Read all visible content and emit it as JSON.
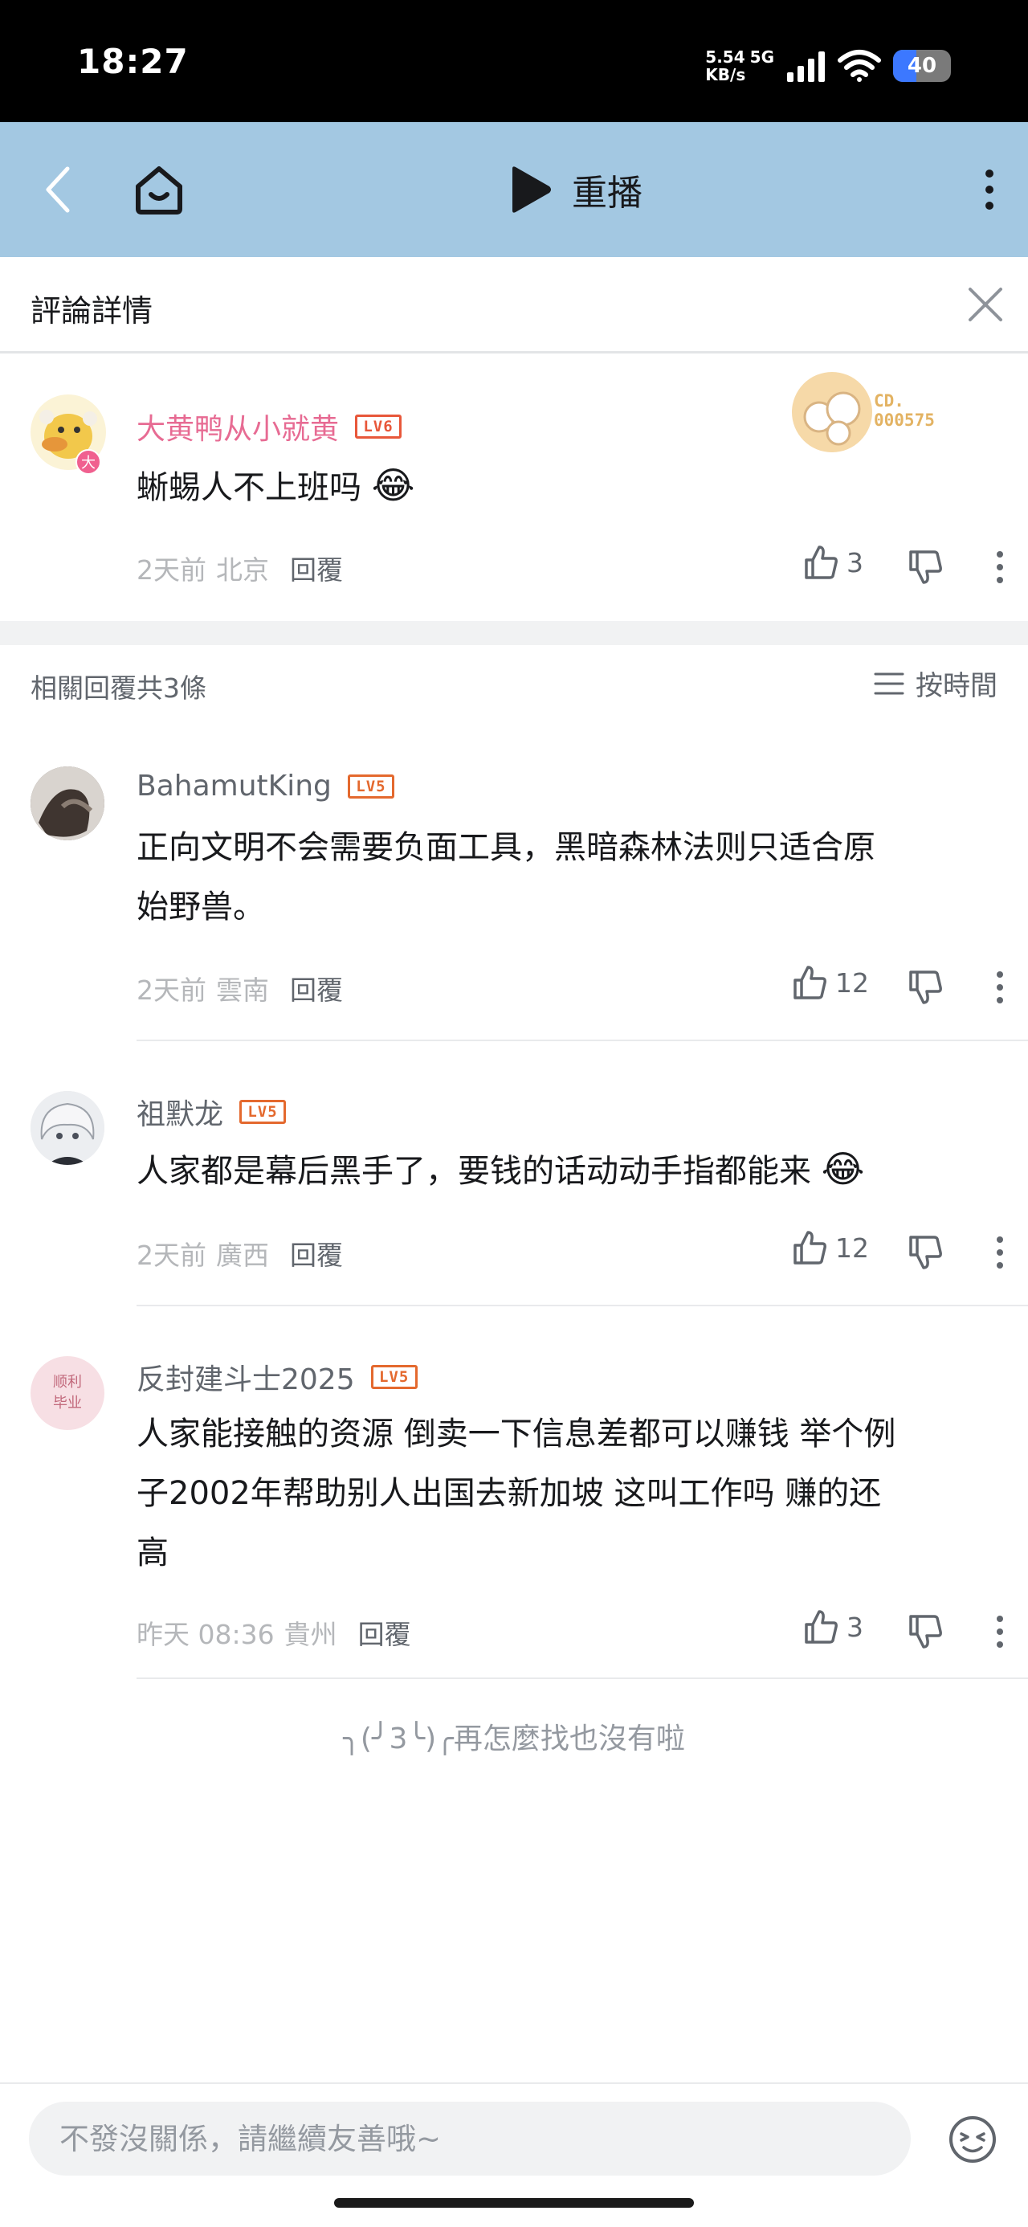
{
  "status_bar": {
    "time": "18:27",
    "net_speed_value": "5.54",
    "net_speed_unit": "KB/s",
    "network": "5G",
    "battery": "40",
    "battery_level": 0.4
  },
  "nav": {
    "replay_label": "重播"
  },
  "detail": {
    "title": "評論詳情"
  },
  "root_comment": {
    "username": "大黄鸭从小就黄",
    "level": "LV6",
    "avatar_badge": "大",
    "fan_badge_text_1": "CD.",
    "fan_badge_text_2": "000575",
    "text": "蜥蜴人不上班吗",
    "emoji": "😂",
    "time": "2天前",
    "location": "北京",
    "reply_label": "回覆",
    "likes": "3"
  },
  "replies_header": {
    "summary": "相關回覆共3條",
    "sort_label": "按時間"
  },
  "replies": [
    {
      "username": "BahamutKing",
      "level": "LV5",
      "text_line1": "正向文明不会需要负面工具，黑暗森林法则只适合原",
      "text_line2": "始野兽。",
      "time": "2天前",
      "location": "雲南",
      "reply_label": "回覆",
      "likes": "12"
    },
    {
      "username": "祖默龙",
      "level": "LV5",
      "text_line1": "人家都是幕后黑手了，要钱的话动动手指都能来",
      "emoji": "😂",
      "time": "2天前",
      "location": "廣西",
      "reply_label": "回覆",
      "likes": "12"
    },
    {
      "username": "反封建斗士2025",
      "level": "LV5",
      "avatar_text_1": "顺利",
      "avatar_text_2": "毕业",
      "text_line1": "人家能接触的资源 倒卖一下信息差都可以赚钱 举个例",
      "text_line2": "子2002年帮助别人出国去新加坡 这叫工作吗 赚的还",
      "text_line3": "高",
      "time": "昨天 08:36",
      "location": "貴州",
      "reply_label": "回覆",
      "likes": "3"
    }
  ],
  "end_text": "╮(╯3╰)╭再怎麼找也沒有啦",
  "input": {
    "placeholder": "不發沒關係，請繼續友善哦~"
  },
  "colors": {
    "nav_bg": "#a3c8e2",
    "username_pink": "#e76b93",
    "level_orange": "#e4692e",
    "battery_blue": "#3c78ff"
  }
}
